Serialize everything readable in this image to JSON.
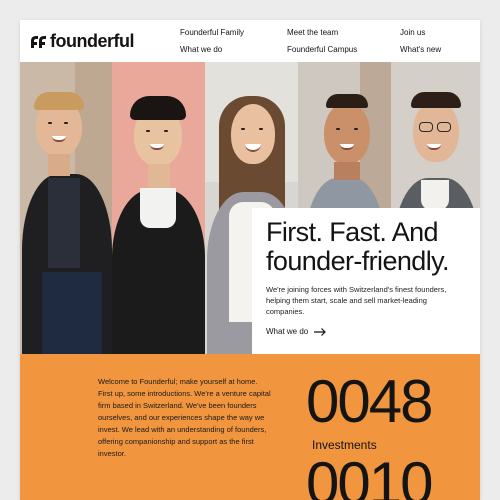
{
  "brand": {
    "name": "founderful"
  },
  "nav": {
    "items": [
      {
        "label": "Founderful Family"
      },
      {
        "label": "Meet the team"
      },
      {
        "label": "Join us"
      },
      {
        "label": "What we do"
      },
      {
        "label": "Founderful Campus"
      },
      {
        "label": "What's new"
      }
    ]
  },
  "hero": {
    "title_line1": "First. Fast. And",
    "title_line2": "founder-friendly.",
    "description": "We're joining forces with Switzerland's finest founders, helping them start, scale and sell market-leading companies.",
    "cta_label": "What we do"
  },
  "intro": {
    "text": "Welcome to Founderful; make yourself at home. First up, some introductions. We're a venture capital firm based in Switzerland. We've been founders ourselves, and our experiences shape the way we invest. We lead with an understanding of founders, offering companionship and support as the first investor."
  },
  "stats": [
    {
      "value": "0048",
      "label": "Investments"
    },
    {
      "value": "0010",
      "label": ""
    }
  ],
  "colors": {
    "accent_orange": "#f1953f",
    "text_dark": "#141414",
    "photo_bg_pink": "#e9a89a",
    "photo_bg_beige": "#cbb9a8"
  }
}
